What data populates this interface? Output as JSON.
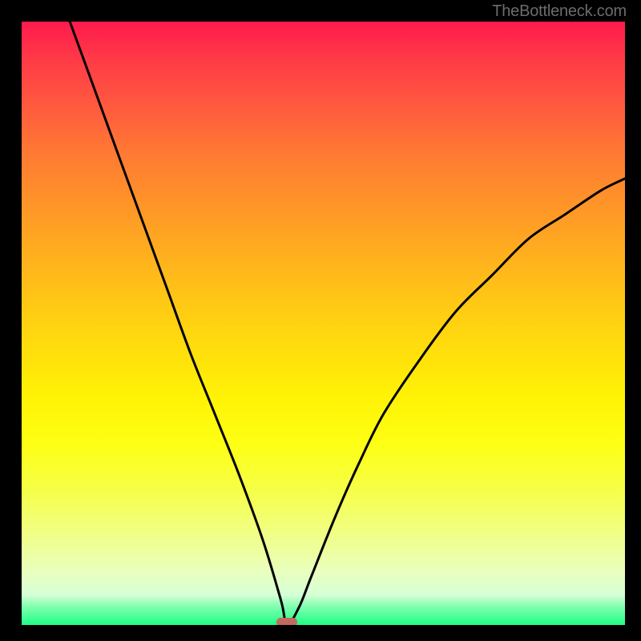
{
  "watermark": "TheBottleneck.com",
  "colors": {
    "frame": "#000000",
    "curve": "#000000",
    "marker": "#c36a60"
  },
  "chart_data": {
    "type": "line",
    "title": "",
    "xlabel": "",
    "ylabel": "",
    "xlim": [
      0,
      100
    ],
    "ylim": [
      0,
      100
    ],
    "grid": false,
    "legend": false,
    "background_gradient": [
      "#ff1a4d",
      "#ffba1a",
      "#fff205",
      "#1eff86"
    ],
    "marker": {
      "x": 44,
      "y": 0,
      "shape": "rounded-rect"
    },
    "series": [
      {
        "name": "bottleneck-curve",
        "x": [
          8,
          12,
          16,
          20,
          24,
          28,
          32,
          36,
          40,
          43,
          44,
          46,
          48,
          52,
          56,
          60,
          66,
          72,
          78,
          84,
          90,
          96,
          100
        ],
        "y": [
          100,
          89,
          78,
          67,
          56,
          45,
          35,
          25,
          14,
          4,
          0,
          3,
          8,
          18,
          27,
          35,
          44,
          52,
          58,
          64,
          68,
          72,
          74
        ]
      }
    ]
  }
}
